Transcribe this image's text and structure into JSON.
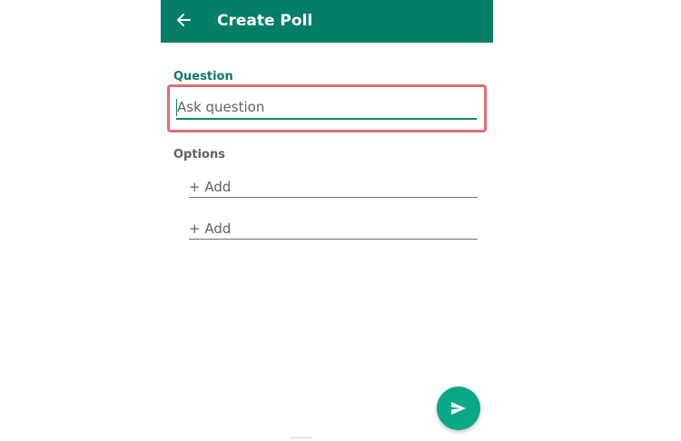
{
  "appbar": {
    "title": "Create Poll",
    "back_icon": "arrow-left-icon",
    "background": "#057e67"
  },
  "question": {
    "label": "Question",
    "placeholder": "Ask question",
    "value": ""
  },
  "options": {
    "label": "Options",
    "items": [
      {
        "placeholder": "+ Add",
        "value": ""
      },
      {
        "placeholder": "+ Add",
        "value": ""
      }
    ]
  },
  "send_button": {
    "icon": "send-icon",
    "color": "#0aa884"
  },
  "colors": {
    "accent": "#087b66",
    "highlight": "#e06c73"
  }
}
